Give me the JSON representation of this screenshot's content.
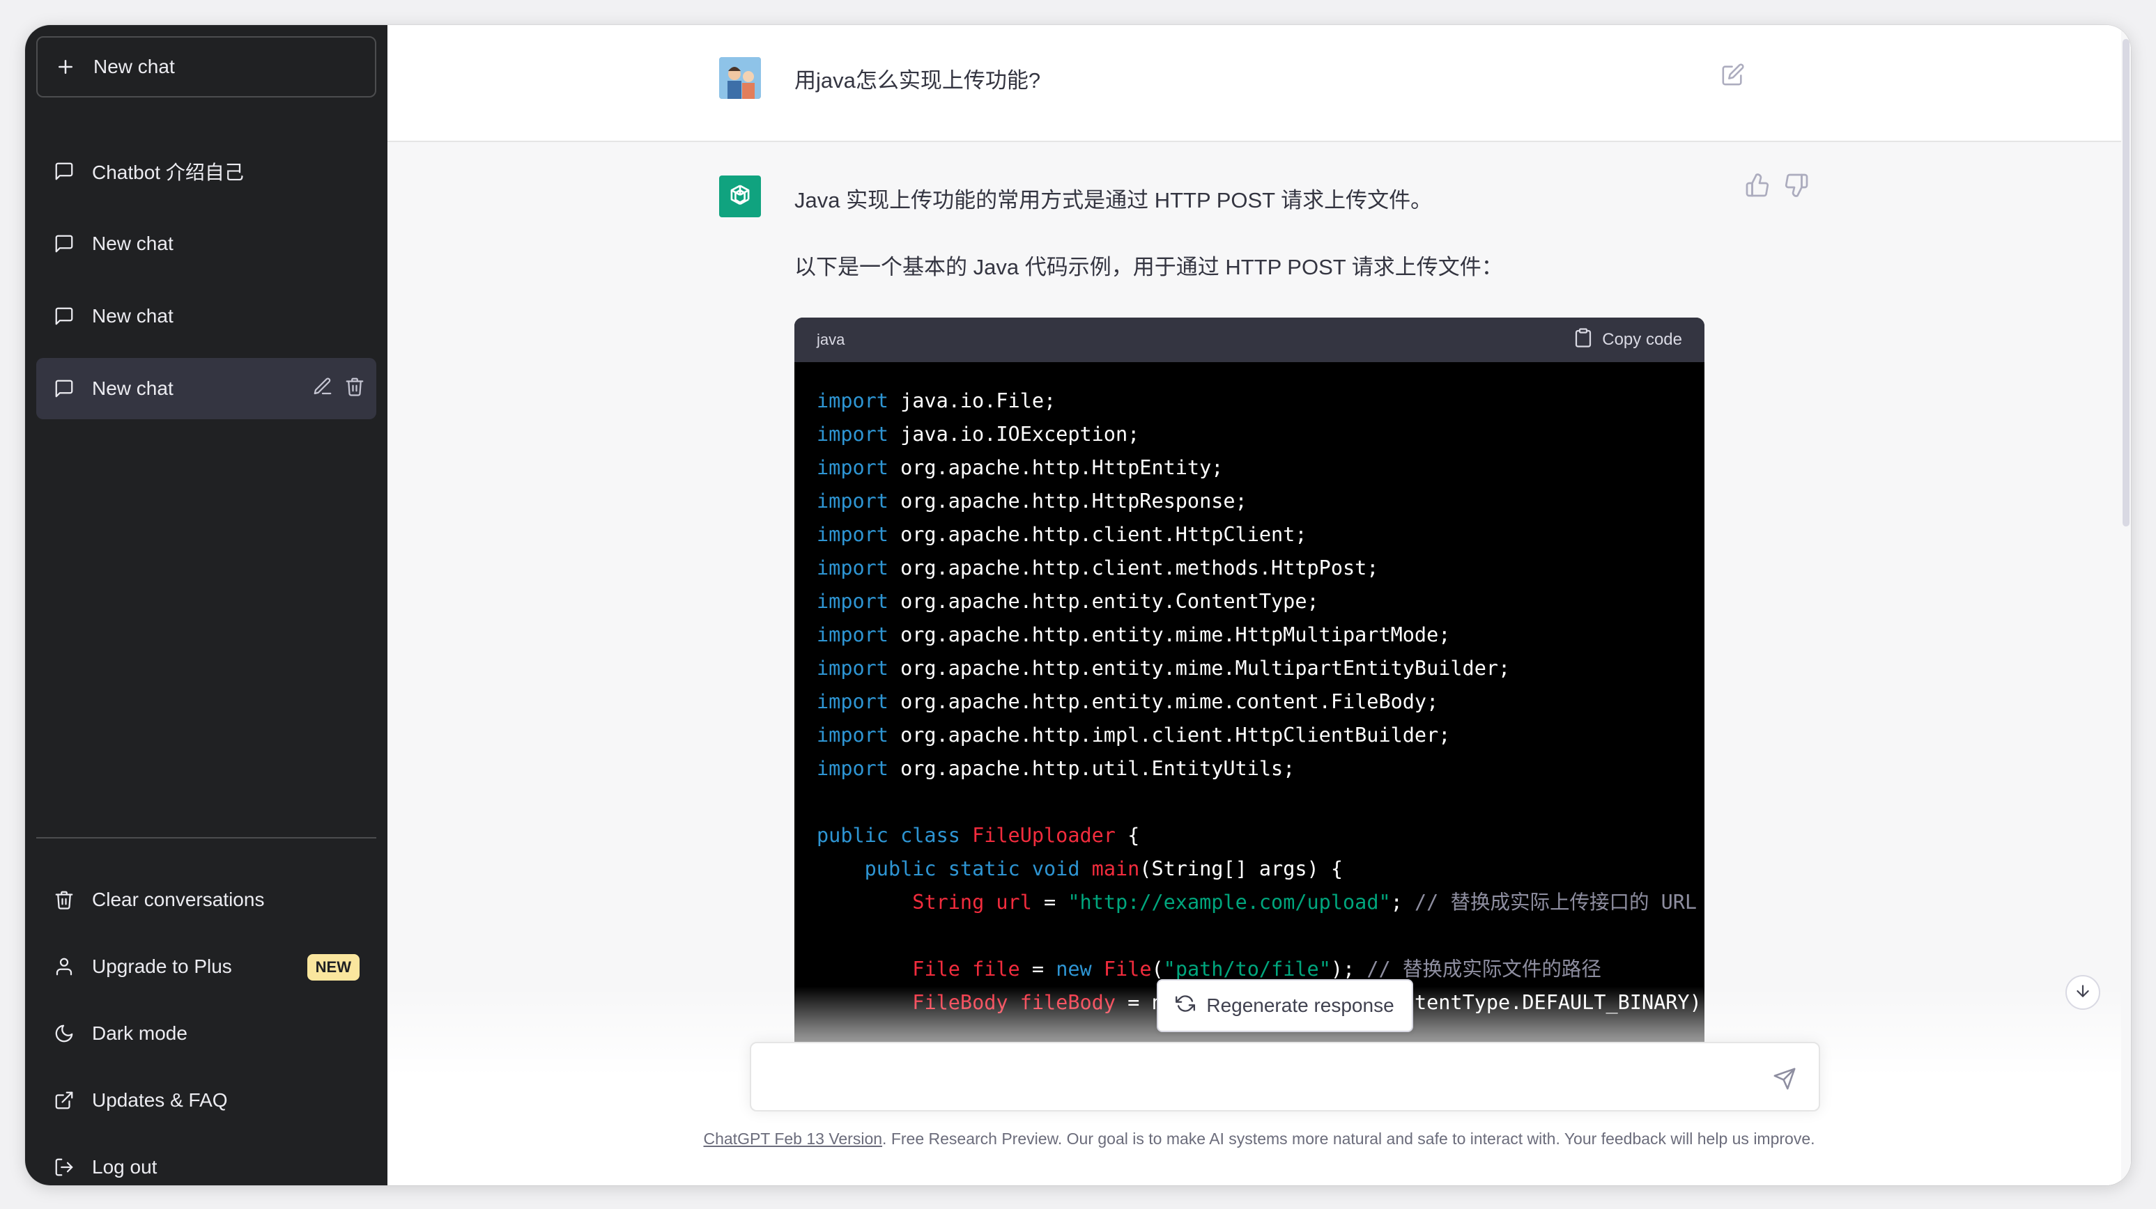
{
  "sidebar": {
    "new_chat_label": "New chat",
    "chats": [
      {
        "label": "Chatbot 介绍自己"
      },
      {
        "label": "New chat"
      },
      {
        "label": "New chat"
      },
      {
        "label": "New chat"
      }
    ],
    "bottom": [
      {
        "label": "Clear conversations",
        "icon": "trash-icon"
      },
      {
        "label": "Upgrade to Plus",
        "icon": "user-icon",
        "badge": "NEW"
      },
      {
        "label": "Dark mode",
        "icon": "moon-icon"
      },
      {
        "label": "Updates & FAQ",
        "icon": "external-link-icon"
      },
      {
        "label": "Log out",
        "icon": "logout-icon"
      }
    ]
  },
  "conversation": {
    "user_message": "用java怎么实现上传功能?",
    "bot_paragraph_1": "Java 实现上传功能的常用方式是通过 HTTP POST 请求上传文件。",
    "bot_paragraph_2": "以下是一个基本的 Java 代码示例，用于通过 HTTP POST 请求上传文件：",
    "code": {
      "language": "java",
      "copy_label": "Copy code",
      "lines": [
        [
          [
            "kw",
            "import"
          ],
          [
            "t",
            " java.io.File;"
          ]
        ],
        [
          [
            "kw",
            "import"
          ],
          [
            "t",
            " java.io.IOException;"
          ]
        ],
        [
          [
            "kw",
            "import"
          ],
          [
            "t",
            " org.apache.http.HttpEntity;"
          ]
        ],
        [
          [
            "kw",
            "import"
          ],
          [
            "t",
            " org.apache.http.HttpResponse;"
          ]
        ],
        [
          [
            "kw",
            "import"
          ],
          [
            "t",
            " org.apache.http.client.HttpClient;"
          ]
        ],
        [
          [
            "kw",
            "import"
          ],
          [
            "t",
            " org.apache.http.client.methods.HttpPost;"
          ]
        ],
        [
          [
            "kw",
            "import"
          ],
          [
            "t",
            " org.apache.http.entity.ContentType;"
          ]
        ],
        [
          [
            "kw",
            "import"
          ],
          [
            "t",
            " org.apache.http.entity.mime.HttpMultipartMode;"
          ]
        ],
        [
          [
            "kw",
            "import"
          ],
          [
            "t",
            " org.apache.http.entity.mime.MultipartEntityBuilder;"
          ]
        ],
        [
          [
            "kw",
            "import"
          ],
          [
            "t",
            " org.apache.http.entity.mime.content.FileBody;"
          ]
        ],
        [
          [
            "kw",
            "import"
          ],
          [
            "t",
            " org.apache.http.impl.client.HttpClientBuilder;"
          ]
        ],
        [
          [
            "kw",
            "import"
          ],
          [
            "t",
            " org.apache.http.util.EntityUtils;"
          ]
        ],
        [],
        [
          [
            "kw",
            "public class "
          ],
          [
            "cls",
            "FileUploader"
          ],
          [
            "t",
            " {"
          ]
        ],
        [
          [
            "t",
            "    "
          ],
          [
            "kw",
            "public static void "
          ],
          [
            "cls",
            "main"
          ],
          [
            "t",
            "(String[] args) {"
          ]
        ],
        [
          [
            "t",
            "        "
          ],
          [
            "cls",
            "String url"
          ],
          [
            "t",
            " = "
          ],
          [
            "str",
            "\"http://example.com/upload\""
          ],
          [
            "t",
            "; "
          ],
          [
            "com",
            "// 替换成实际上传接口的 URL"
          ]
        ],
        [],
        [
          [
            "t",
            "        "
          ],
          [
            "cls",
            "File file"
          ],
          [
            "t",
            " = "
          ],
          [
            "kw",
            "new "
          ],
          [
            "cls",
            "File"
          ],
          [
            "t",
            "("
          ],
          [
            "str",
            "\"path/to/file\""
          ],
          [
            "t",
            "); "
          ],
          [
            "com",
            "// 替换成实际文件的路径"
          ]
        ],
        [
          [
            "t",
            "        "
          ],
          [
            "cls",
            "FileBody fileBody"
          ],
          [
            "t",
            " = new FileBody(file, ContentType.DEFAULT_BINARY);"
          ]
        ]
      ]
    },
    "regenerate_label": "Regenerate response"
  },
  "input": {
    "placeholder": ""
  },
  "footer": {
    "link_text": "ChatGPT Feb 13 Version",
    "text": ". Free Research Preview. Our goal is to make AI systems more natural and safe to interact with. Your feedback will help us improve."
  },
  "colors": {
    "sidebar_bg": "#202123",
    "accent": "#10a37f",
    "code_keyword": "#2e95d3",
    "code_class": "#f22c3d",
    "code_string": "#00a67d"
  }
}
